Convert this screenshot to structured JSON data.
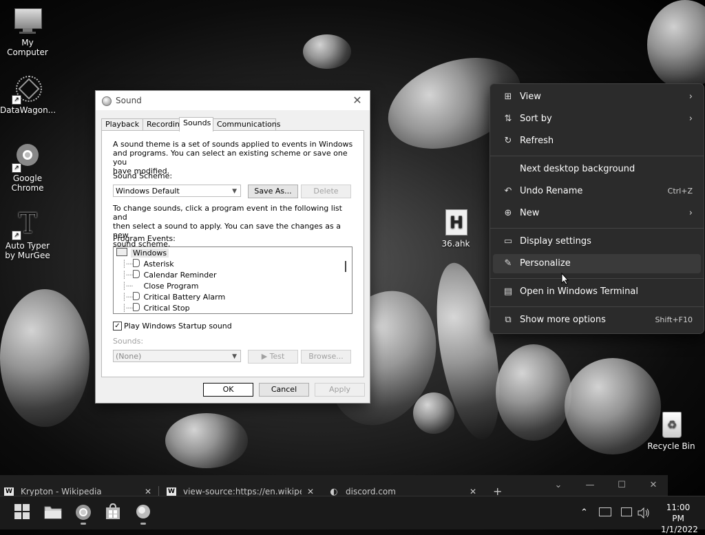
{
  "desktop": {
    "icons": [
      {
        "label": "My Computer"
      },
      {
        "label": "DataWagon..."
      },
      {
        "label": "Google Chrome"
      },
      {
        "label": "Auto Typer by MurGee"
      },
      {
        "label": "36.ahk",
        "glyph": "H"
      },
      {
        "label": "Recycle Bin"
      }
    ]
  },
  "dialog": {
    "title": "Sound",
    "close_glyph": "✕",
    "tabs": [
      "Playback",
      "Recording",
      "Sounds",
      "Communications"
    ],
    "active_tab": "Sounds",
    "intro": "A sound theme is a set of sounds applied to events in Windows and programs.  You can select an existing scheme or save one you have modified.",
    "intro_lines": [
      "A sound theme is a set of sounds applied to events in Windows",
      "and programs.  You can select an existing scheme or save one you",
      "have modified."
    ],
    "scheme_label": "Sound Scheme:",
    "scheme_value": "Windows Default",
    "save_as": "Save As...",
    "delete": "Delete",
    "instructions_lines": [
      "To change sounds, click a program event in the following list and",
      "then select a sound to apply.  You can save the changes as a new",
      "sound scheme."
    ],
    "events_label": "Program Events:",
    "events": [
      {
        "label": "Windows",
        "root": true
      },
      {
        "label": "Asterisk",
        "icon": true
      },
      {
        "label": "Calendar Reminder",
        "icon": true
      },
      {
        "label": "Close Program",
        "icon": false
      },
      {
        "label": "Critical Battery Alarm",
        "icon": true
      },
      {
        "label": "Critical Stop",
        "icon": true
      }
    ],
    "startup_checked": true,
    "startup_label": "Play Windows Startup sound",
    "sounds_label": "Sounds:",
    "sounds_value": "(None)",
    "test": "▶ Test",
    "browse": "Browse...",
    "ok": "OK",
    "cancel": "Cancel",
    "apply": "Apply"
  },
  "context_menu": {
    "items": [
      {
        "label": "View",
        "icon": "grid-icon",
        "glyph": "⊞",
        "submenu": true
      },
      {
        "label": "Sort by",
        "icon": "sort-icon",
        "glyph": "⇅",
        "submenu": true
      },
      {
        "label": "Refresh",
        "icon": "refresh-icon",
        "glyph": "↻"
      },
      {
        "label": "Next desktop background"
      },
      {
        "label": "Undo Rename",
        "icon": "undo-icon",
        "glyph": "↶",
        "shortcut": "Ctrl+Z"
      },
      {
        "label": "New",
        "icon": "plus-icon",
        "glyph": "⊕",
        "submenu": true
      },
      {
        "label": "Display settings",
        "icon": "display-icon",
        "glyph": "▭"
      },
      {
        "label": "Personalize",
        "icon": "brush-icon",
        "glyph": "✎"
      },
      {
        "label": "Open in Windows Terminal",
        "icon": "terminal-icon",
        "glyph": "▤"
      },
      {
        "label": "Show more options",
        "icon": "more-options-icon",
        "glyph": "⧉",
        "shortcut": "Shift+F10"
      }
    ],
    "submenu_glyph": "›"
  },
  "browser_tabs": [
    {
      "label": "Krypton - Wikipedia",
      "fav": "W"
    },
    {
      "label": "view-source:https://en.wikipedia",
      "fav": "W"
    },
    {
      "label": "discord.com",
      "fav": "◐"
    }
  ],
  "browser_controls": {
    "close": "✕",
    "new_tab": "+",
    "chevron": "⌄",
    "minimize": "—",
    "maximize": "☐",
    "window_close": "✕"
  },
  "taskbar": {
    "time": "11:00 PM",
    "date": "1/1/2022",
    "tray_chevron": "⌃"
  }
}
